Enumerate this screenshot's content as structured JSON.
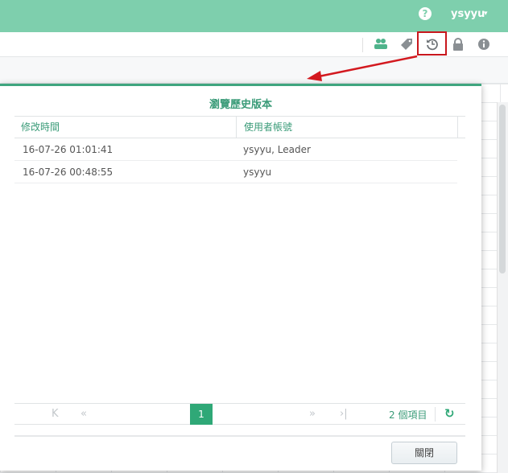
{
  "header": {
    "help_icon": "?",
    "user": "ysyyu",
    "caret": "▾"
  },
  "toolbar": {
    "icons": [
      "share-icon",
      "tag-icon",
      "history-icon",
      "lock-icon",
      "info-icon"
    ]
  },
  "dialog": {
    "title": "瀏覽歷史版本",
    "columns": [
      "修改時間",
      "使用者帳號"
    ],
    "rows": [
      {
        "time": "16-07-26 01:01:41",
        "user": "ysyyu, Leader"
      },
      {
        "time": "16-07-26 00:48:55",
        "user": "ysyyu"
      }
    ],
    "pager": {
      "first": "K",
      "prev": "«",
      "page": "1",
      "next": "»",
      "last": "›|",
      "count": "2 個項目",
      "refresh": "↻"
    },
    "close_label": "關閉"
  },
  "colors": {
    "accent": "#2fa877",
    "header": "#7ecfad",
    "annotation": "#c8171d"
  }
}
